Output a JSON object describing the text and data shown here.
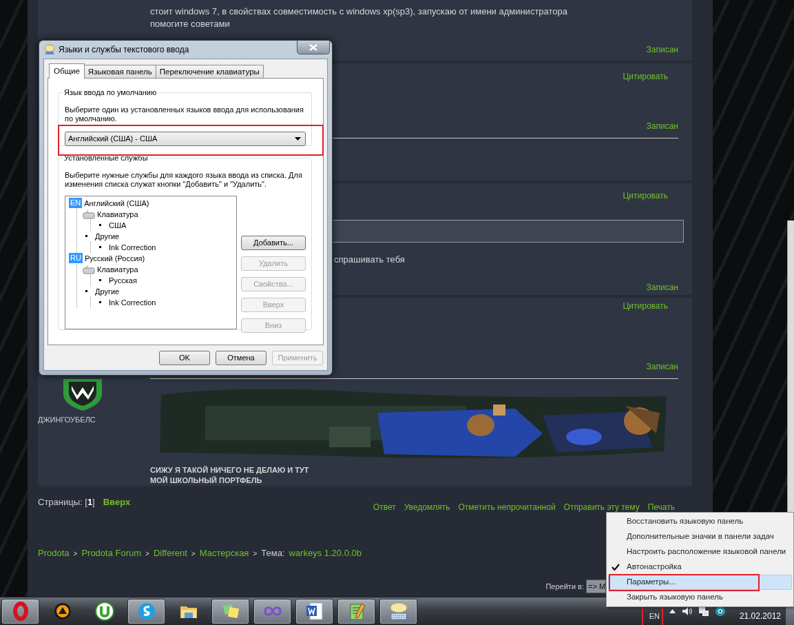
{
  "forum": {
    "posts": [
      {
        "body": [
          "стоит windows 7, в свойствах совместимость с windows xp(sp3), запускаю от имени администратора",
          "помогите советами"
        ],
        "footer": "Записан"
      },
      {
        "quote_link": "Цитировать",
        "footer": "Записан",
        "divider": true
      },
      {
        "quote_link": "Цитировать",
        "quote_box": true,
        "body": [
          "спрашивать тебя"
        ],
        "footer": "Записан"
      },
      {
        "quote_link": "Цитировать",
        "footer": "Записан",
        "divider": true,
        "author": "ДЖИНГОУБЕЛС",
        "signature": {
          "links": [
            "СИЖУ Я ТАКОЙ НИЧЕГО НЕ ДЕЛАЮ И ТУТ",
            "МОЙ ШКОЛЬНЫЙ ПОРТФЕЛЬ"
          ]
        }
      }
    ],
    "pages": "Страницы: [**1**]",
    "top_link": "Вверх",
    "actions": [
      "Ответ",
      "Уведомлять",
      "Отметить непрочитанной",
      "Отправить эту тему",
      "Печать"
    ],
    "breadcrumb": [
      {
        "label": "Prodota",
        "kind": "link"
      },
      {
        "label": ">",
        "kind": "separator"
      },
      {
        "label": "Prodota Forum",
        "kind": "link"
      },
      {
        "label": ">",
        "kind": "separator"
      },
      {
        "label": "Different",
        "kind": "link"
      },
      {
        "label": ">",
        "kind": "separator"
      },
      {
        "label": "Мастерская",
        "kind": "link"
      },
      {
        "label": ">",
        "kind": "separator"
      },
      {
        "label": "Тема:",
        "kind": "plain"
      },
      {
        "label": "warkeys 1.20.0.0b",
        "kind": "link"
      }
    ],
    "jump": {
      "label": "Перейти в:",
      "value": "=> M"
    }
  },
  "dialog": {
    "title": "Языки и службы текстового ввода",
    "tabs": [
      {
        "label": "Общие",
        "selected": true
      },
      {
        "label": "Языковая панель",
        "selected": false
      },
      {
        "label": "Переключение клавиатуры",
        "selected": false
      }
    ],
    "default_language": {
      "legend": "Язык ввода по умолчанию",
      "description": "Выберите один из установленных языков ввода для использования по умолчанию.",
      "value": "Английский (США) - США",
      "annotated": true
    },
    "services": {
      "legend": "Установленные службы",
      "description": "Выберите нужные службы для каждого языка ввода из списка. Для изменения списка служат кнопки \"Добавить\" и \"Удалить\".",
      "tree": [
        {
          "kind": "language",
          "badge": "EN",
          "label": "Английский (США)",
          "children": [
            {
              "kind": "keyboard",
              "label": "Клавиатура",
              "children": [
                {
                  "kind": "bullet",
                  "label": "США"
                }
              ]
            },
            {
              "kind": "bullet",
              "label": "Другие",
              "children": [
                {
                  "kind": "bullet",
                  "label": "Ink Correction"
                }
              ]
            }
          ]
        },
        {
          "kind": "language",
          "badge": "RU",
          "label": "Русский (Россия)",
          "children": [
            {
              "kind": "keyboard",
              "label": "Клавиатура",
              "children": [
                {
                  "kind": "bullet",
                  "label": "Русская"
                }
              ]
            },
            {
              "kind": "bullet",
              "label": "Другие",
              "children": [
                {
                  "kind": "bullet",
                  "label": "Ink Correction"
                }
              ]
            }
          ]
        }
      ],
      "buttons": [
        {
          "label": "Добавить...",
          "disabled": false
        },
        {
          "label": "Удалить",
          "disabled": true
        },
        {
          "label": "Свойства...",
          "disabled": true
        },
        {
          "label": "Вверх",
          "disabled": true
        },
        {
          "label": "Вниз",
          "disabled": true
        }
      ]
    },
    "buttons": [
      {
        "label": "OK",
        "disabled": false
      },
      {
        "label": "Отмена",
        "disabled": false
      },
      {
        "label": "Применить",
        "disabled": true
      }
    ]
  },
  "context_menu": {
    "items": [
      {
        "label": "Восстановить языковую панель",
        "checked": false,
        "selected": false,
        "annotated": false
      },
      {
        "label": "Дополнительные значки в панели задач",
        "checked": false,
        "selected": false,
        "annotated": false
      },
      {
        "label": "Настроить расположение языковой панели",
        "checked": false,
        "selected": false,
        "annotated": false
      },
      {
        "label": "Автонастройка",
        "checked": true,
        "selected": false,
        "annotated": false
      },
      {
        "label": "Параметры...",
        "checked": false,
        "selected": true,
        "annotated": true
      },
      {
        "label": "Закрыть языковую панель",
        "checked": false,
        "selected": false,
        "annotated": false
      }
    ]
  },
  "taskbar": {
    "apps": [
      {
        "kind": "ring",
        "running": true
      },
      {
        "kind": "player",
        "running": false
      },
      {
        "kind": "torrent",
        "running": false
      },
      {
        "kind": "messenger",
        "running": true
      },
      {
        "kind": "folder",
        "running": false
      },
      {
        "kind": "notes",
        "running": true
      },
      {
        "kind": "infinity",
        "running": true
      },
      {
        "kind": "document",
        "running": true
      },
      {
        "kind": "notepad",
        "running": true
      },
      {
        "kind": "bubble",
        "running": true
      }
    ],
    "language": {
      "label": "EN",
      "annotated": true
    },
    "date": "21.02.2012"
  }
}
